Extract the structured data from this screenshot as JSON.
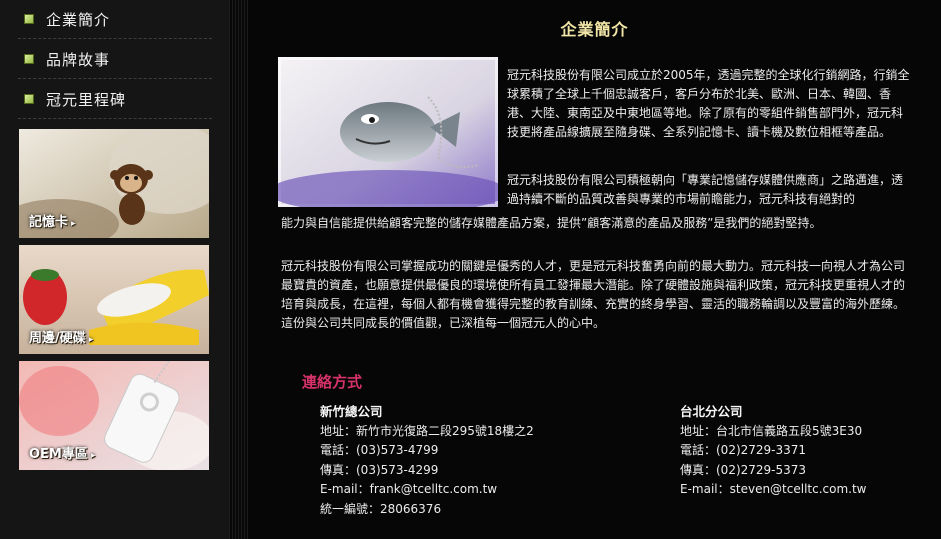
{
  "sidebar": {
    "nav": [
      {
        "label": "企業簡介"
      },
      {
        "label": "品牌故事"
      },
      {
        "label": "冠元里程碑"
      }
    ],
    "banners": [
      {
        "caption": "記憶卡",
        "arrow": "▸"
      },
      {
        "caption": "周邊/硬碟",
        "arrow": "▸"
      },
      {
        "caption": "OEM專區",
        "arrow": "▸"
      }
    ]
  },
  "main": {
    "title": "企業簡介",
    "paragraph_1": "冠元科技股份有限公司成立於2005年，透過完整的全球化行銷網路，行銷全球累積了全球上千個忠誠客戶，客戶分布於北美、歐洲、日本、韓國、香港、大陸、東南亞及中東地區等地。除了原有的零組件銷售部門外，冠元科技更將產品線擴展至隨身碟、全系列記憶卡、讀卡機及數位相框等產品。",
    "paragraph_2a": "冠元科技股份有限公司積極朝向「專業記憶儲存媒體供應商」之路邁進，透過持續不斷的品質改善與專業的市場前瞻能力，冠元科技有絕對的",
    "paragraph_2b": "能力與自信能提供給顧客完整的儲存媒體產品方案，提供”顧客滿意的產品及服務”是我們的絕對堅持。",
    "paragraph_3": "冠元科技股份有限公司掌握成功的關鍵是優秀的人才，更是冠元科技奮勇向前的最大動力。冠元科技一向視人才為公司最寶貴的資產，也願意提供最優良的環境使所有員工發揮最大潛能。除了硬體設施與福利政策，冠元科技更重視人才的培育與成長，在這裡，每個人都有機會獲得完整的教育訓練、充實的終身學習、靈活的職務輪調以及豐富的海外歷練。這份與公司共同成長的價值觀，已深植每一個冠元人的心中。"
  },
  "contact": {
    "heading": "連絡方式",
    "hq": {
      "name": "新竹總公司",
      "address": "地址：新竹市光復路二段295號18樓之2",
      "phone": "電話：(03)573-4799",
      "fax": "傳真：(03)573-4299",
      "email": "E-mail：frank@tcelltc.com.tw",
      "tax_id": "統一編號：28066376"
    },
    "branch": {
      "name": "台北分公司",
      "address": "地址：台北市信義路五段5號3E30",
      "phone": "電話：(02)2729-3371",
      "fax": "傳真：(02)2729-5373",
      "email": "E-mail：steven@tcelltc.com.tw"
    }
  },
  "colors": {
    "title": "#f1e6a8",
    "contact_heading": "#d6326a",
    "nav_bullet": "#8ab232",
    "background": "#060606"
  }
}
